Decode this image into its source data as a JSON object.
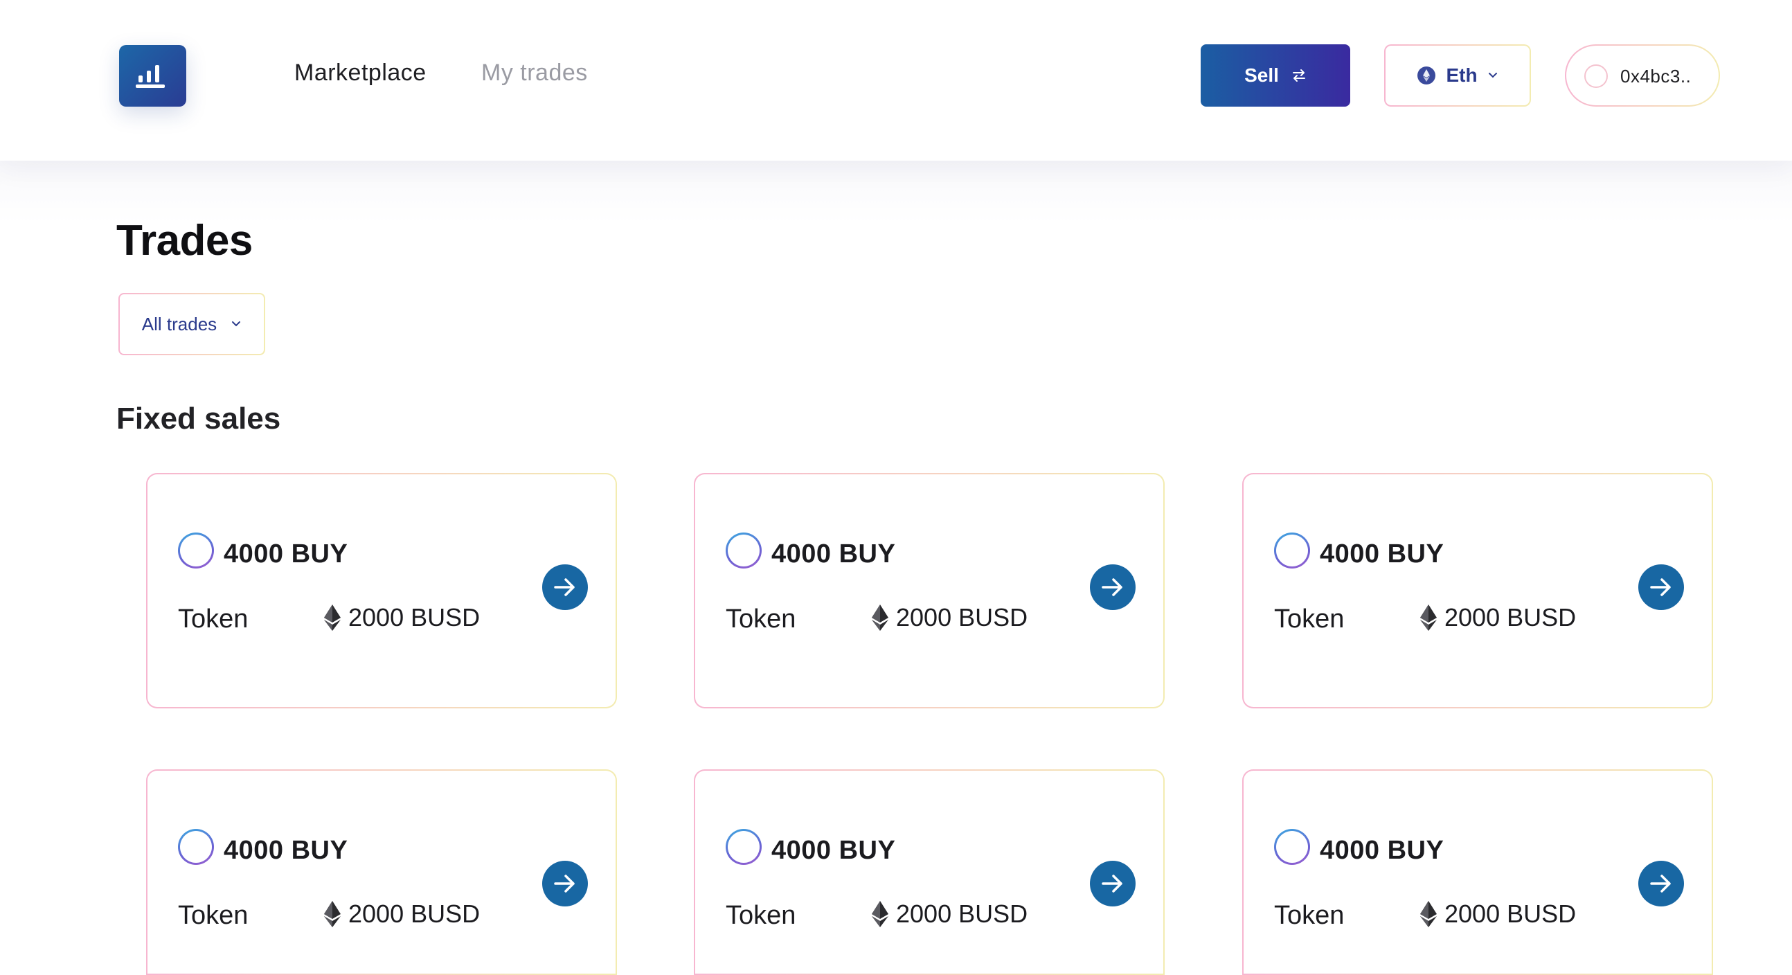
{
  "header": {
    "nav": [
      {
        "label": "Marketplace"
      },
      {
        "label": "My trades"
      }
    ],
    "sell_label": "Sell",
    "chain_label": "Eth",
    "wallet_address": "0x4bc3.."
  },
  "page": {
    "title": "Trades",
    "filter_label": "All trades",
    "section_title": "Fixed sales"
  },
  "cards": [
    {
      "amount": "4000 BUY",
      "token": "Token",
      "price": "2000 BUSD"
    },
    {
      "amount": "4000 BUY",
      "token": "Token",
      "price": "2000 BUSD"
    },
    {
      "amount": "4000 BUY",
      "token": "Token",
      "price": "2000 BUSD"
    },
    {
      "amount": "4000 BUY",
      "token": "Token",
      "price": "2000 BUSD"
    },
    {
      "amount": "4000 BUY",
      "token": "Token",
      "price": "2000 BUSD"
    },
    {
      "amount": "4000 BUY",
      "token": "Token",
      "price": "2000 BUSD"
    }
  ],
  "icons": {
    "logo": "bar-chart-logo-icon",
    "sell": "swap-arrows-icon",
    "chain": "ethereum-icon",
    "dropdown": "chevron-down-icon",
    "card_action": "arrow-right-icon",
    "price": "ethereum-icon"
  },
  "colors": {
    "primary": "#1867a3",
    "accent_purple": "#3a2aa0",
    "border_pink": "#f7b6d0",
    "border_yellow": "#f3ecb1"
  }
}
